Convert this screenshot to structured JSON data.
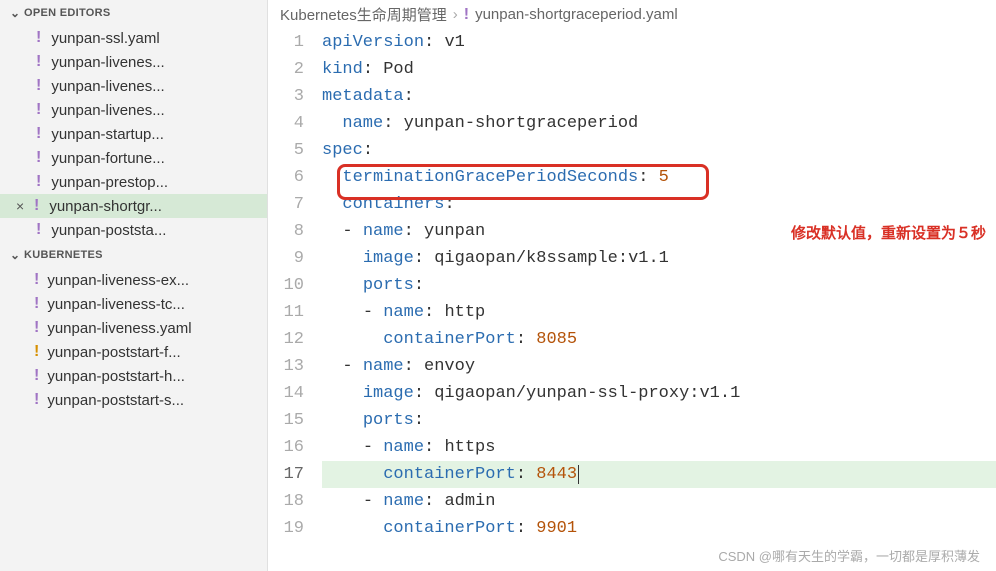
{
  "sidebar": {
    "openEditorsLabel": "OPEN EDITORS",
    "kubernetesLabel": "KUBERNETES",
    "openEditors": [
      {
        "name": "yunpan-ssl.yaml",
        "modified": true,
        "color": "purple"
      },
      {
        "name": "yunpan-livenes...",
        "modified": true,
        "color": "purple"
      },
      {
        "name": "yunpan-livenes...",
        "modified": true,
        "color": "purple"
      },
      {
        "name": "yunpan-livenes...",
        "modified": true,
        "color": "purple"
      },
      {
        "name": "yunpan-startup...",
        "modified": true,
        "color": "purple"
      },
      {
        "name": "yunpan-fortune...",
        "modified": true,
        "color": "purple"
      },
      {
        "name": "yunpan-prestop...",
        "modified": true,
        "color": "purple"
      },
      {
        "name": "yunpan-shortgr...",
        "modified": true,
        "color": "purple",
        "active": true
      },
      {
        "name": "yunpan-poststa...",
        "modified": true,
        "color": "purple"
      }
    ],
    "explorer": [
      {
        "name": "yunpan-liveness-ex...",
        "modified": true,
        "color": "purple"
      },
      {
        "name": "yunpan-liveness-tc...",
        "modified": true,
        "color": "purple"
      },
      {
        "name": "yunpan-liveness.yaml",
        "modified": true,
        "color": "purple"
      },
      {
        "name": "yunpan-poststart-f...",
        "modified": true,
        "color": "orange"
      },
      {
        "name": "yunpan-poststart-h...",
        "modified": true,
        "color": "purple"
      },
      {
        "name": "yunpan-poststart-s...",
        "modified": true,
        "color": "purple"
      }
    ]
  },
  "breadcrumb": {
    "folder": "Kubernetes生命周期管理",
    "file": "yunpan-shortgraceperiod.yaml"
  },
  "code": {
    "lines": [
      {
        "n": 1,
        "tokens": [
          [
            "key",
            "apiVersion"
          ],
          [
            "str",
            ": "
          ],
          [
            "str",
            "v1"
          ]
        ]
      },
      {
        "n": 2,
        "tokens": [
          [
            "key",
            "kind"
          ],
          [
            "str",
            ": "
          ],
          [
            "str",
            "Pod"
          ]
        ]
      },
      {
        "n": 3,
        "tokens": [
          [
            "key",
            "metadata"
          ],
          [
            "str",
            ":"
          ]
        ]
      },
      {
        "n": 4,
        "tokens": [
          [
            "guide",
            "  "
          ],
          [
            "key",
            "name"
          ],
          [
            "str",
            ": "
          ],
          [
            "str",
            "yunpan-shortgraceperiod"
          ]
        ]
      },
      {
        "n": 5,
        "tokens": [
          [
            "key",
            "spec"
          ],
          [
            "str",
            ":"
          ]
        ]
      },
      {
        "n": 6,
        "tokens": [
          [
            "guide",
            "  "
          ],
          [
            "key",
            "terminationGracePeriodSeconds"
          ],
          [
            "str",
            ": "
          ],
          [
            "num",
            "5"
          ]
        ]
      },
      {
        "n": 7,
        "tokens": [
          [
            "guide",
            "  "
          ],
          [
            "key",
            "containers"
          ],
          [
            "str",
            ":"
          ]
        ]
      },
      {
        "n": 8,
        "tokens": [
          [
            "guide",
            "  "
          ],
          [
            "str",
            "- "
          ],
          [
            "key",
            "name"
          ],
          [
            "str",
            ": "
          ],
          [
            "str",
            "yunpan"
          ]
        ]
      },
      {
        "n": 9,
        "tokens": [
          [
            "guide",
            "    "
          ],
          [
            "key",
            "image"
          ],
          [
            "str",
            ": "
          ],
          [
            "str",
            "qigaopan/k8ssample:v1.1"
          ]
        ]
      },
      {
        "n": 10,
        "tokens": [
          [
            "guide",
            "    "
          ],
          [
            "key",
            "ports"
          ],
          [
            "str",
            ":"
          ]
        ]
      },
      {
        "n": 11,
        "tokens": [
          [
            "guide",
            "    "
          ],
          [
            "str",
            "- "
          ],
          [
            "key",
            "name"
          ],
          [
            "str",
            ": "
          ],
          [
            "str",
            "http"
          ]
        ]
      },
      {
        "n": 12,
        "tokens": [
          [
            "guide",
            "      "
          ],
          [
            "key",
            "containerPort"
          ],
          [
            "str",
            ": "
          ],
          [
            "num",
            "8085"
          ]
        ]
      },
      {
        "n": 13,
        "tokens": [
          [
            "guide",
            "  "
          ],
          [
            "str",
            "- "
          ],
          [
            "key",
            "name"
          ],
          [
            "str",
            ": "
          ],
          [
            "str",
            "envoy"
          ]
        ]
      },
      {
        "n": 14,
        "tokens": [
          [
            "guide",
            "    "
          ],
          [
            "key",
            "image"
          ],
          [
            "str",
            ": "
          ],
          [
            "str",
            "qigaopan/yunpan-ssl-proxy:v1.1"
          ]
        ]
      },
      {
        "n": 15,
        "tokens": [
          [
            "guide",
            "    "
          ],
          [
            "key",
            "ports"
          ],
          [
            "str",
            ":"
          ]
        ]
      },
      {
        "n": 16,
        "tokens": [
          [
            "guide",
            "    "
          ],
          [
            "str",
            "- "
          ],
          [
            "key",
            "name"
          ],
          [
            "str",
            ": "
          ],
          [
            "str",
            "https"
          ]
        ]
      },
      {
        "n": 17,
        "tokens": [
          [
            "guide",
            "      "
          ],
          [
            "key",
            "containerPort"
          ],
          [
            "str",
            ": "
          ],
          [
            "num",
            "8443"
          ]
        ],
        "active": true,
        "cursor": true
      },
      {
        "n": 18,
        "tokens": [
          [
            "guide",
            "    "
          ],
          [
            "str",
            "- "
          ],
          [
            "key",
            "name"
          ],
          [
            "str",
            ": "
          ],
          [
            "str",
            "admin"
          ]
        ]
      },
      {
        "n": 19,
        "tokens": [
          [
            "guide",
            "      "
          ],
          [
            "key",
            "containerPort"
          ],
          [
            "str",
            ": "
          ],
          [
            "num",
            "9901"
          ]
        ]
      }
    ]
  },
  "annotation": "修改默认值，重新设置为５秒",
  "watermark": "CSDN @哪有天生的学霸，一切都是厚积薄发"
}
